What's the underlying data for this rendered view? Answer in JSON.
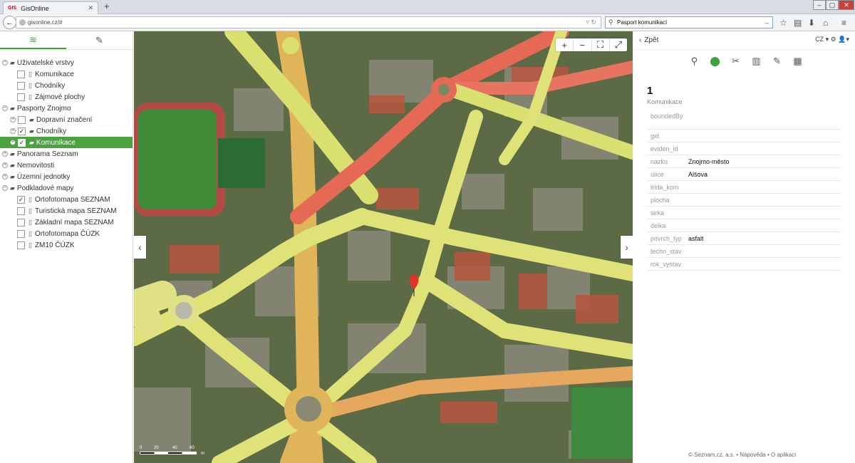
{
  "browser": {
    "tab_title": "GisOnline",
    "favicon_text": "GIS",
    "url": "gisonline.cz/#",
    "search_value": "Pasport komunikací"
  },
  "sidebar": {
    "tree": [
      {
        "level": 0,
        "label": "Uživatelské vrstvy",
        "toggle": "−",
        "folder": true,
        "checked": null
      },
      {
        "level": 2,
        "label": "Komunikace",
        "checked": false,
        "file": true
      },
      {
        "level": 2,
        "label": "Chodníky",
        "checked": false,
        "file": true
      },
      {
        "level": 2,
        "label": "Zájmové plochy",
        "checked": false,
        "file": true
      },
      {
        "level": 0,
        "label": "Pasporty Znojmo",
        "toggle": "−",
        "folder": true,
        "checked": null
      },
      {
        "level": 1,
        "label": "Dopravní značení",
        "toggle": "+",
        "folder": true,
        "checked": false
      },
      {
        "level": 1,
        "label": "Chodníky",
        "toggle": "+",
        "folder": true,
        "checked": true
      },
      {
        "level": 1,
        "label": "Komunikace",
        "toggle": "+",
        "folder": true,
        "checked": true,
        "selected": true
      },
      {
        "level": 0,
        "label": "Panorama Seznam",
        "toggle": "+",
        "folder": true,
        "checked": null
      },
      {
        "level": 0,
        "label": "Nemovitosti",
        "toggle": "+",
        "folder": true,
        "checked": null
      },
      {
        "level": 0,
        "label": "Územní jednotky",
        "toggle": "+",
        "folder": true,
        "checked": null
      },
      {
        "level": 0,
        "label": "Podkladové mapy",
        "toggle": "−",
        "folder": true,
        "checked": null
      },
      {
        "level": 2,
        "label": "Ortofotomapa SEZNAM",
        "checked": true,
        "file": true
      },
      {
        "level": 2,
        "label": "Turistická mapa SEZNAM",
        "checked": false,
        "file": true
      },
      {
        "level": 2,
        "label": "Základní mapa SEZNAM",
        "checked": false,
        "file": true
      },
      {
        "level": 2,
        "label": "Ortofotomapa ČÚZK",
        "checked": false,
        "file": true
      },
      {
        "level": 2,
        "label": "ZM10 ČÚZK",
        "checked": false,
        "file": true
      }
    ]
  },
  "map": {
    "scale_labels": [
      "0",
      "20",
      "40",
      "60",
      "m"
    ]
  },
  "panel": {
    "back_label": "Zpět",
    "lang": "CZ",
    "feature_id": "1",
    "feature_layer": "Komunikace",
    "attributes": [
      {
        "key": "boundedBy",
        "value": ""
      },
      {
        "key": "gid",
        "value": ""
      },
      {
        "key": "eviden_id",
        "value": ""
      },
      {
        "key": "nazku",
        "value": "Znojmo-město"
      },
      {
        "key": "ulice",
        "value": "Alšova"
      },
      {
        "key": "trida_kom",
        "value": ""
      },
      {
        "key": "plocha",
        "value": ""
      },
      {
        "key": "sirka",
        "value": ""
      },
      {
        "key": "delka",
        "value": ""
      },
      {
        "key": "povrch_typ",
        "value": "asfalt"
      },
      {
        "key": "techn_stav",
        "value": ""
      },
      {
        "key": "rok_vystav",
        "value": ""
      }
    ],
    "footer": "© Seznam.cz, a.s.  •  Nápověda  •  O aplikaci"
  }
}
